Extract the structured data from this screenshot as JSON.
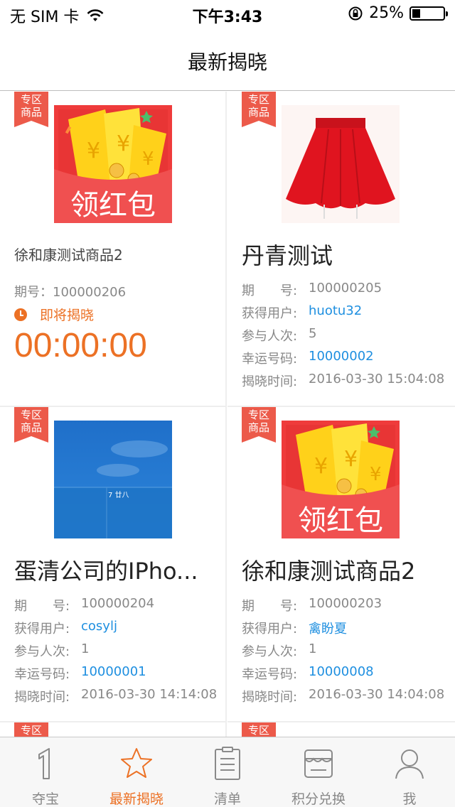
{
  "status_bar": {
    "carrier": "无 SIM 卡",
    "time": "下午3:43",
    "battery": "25%",
    "battery_level": 0.25
  },
  "nav": {
    "title": "最新揭晓"
  },
  "ribbon_text": "专区\n商品",
  "labels": {
    "period_prefix": "期号：",
    "period": "期　　号:",
    "winner": "获得用户:",
    "participants": "参与人次:",
    "lucky_code": "幸运号码:",
    "reveal_time": "揭晓时间:"
  },
  "items": [
    {
      "ribbon": "专区\n商品",
      "image": "red-envelope",
      "image_text": "领红包",
      "name": "徐和康测试商品2",
      "status": "pending",
      "period": "期号：100000206",
      "soon_text": "即将揭晓",
      "countdown": "00:00:00"
    },
    {
      "ribbon": "专区\n商品",
      "image": "red-skirt",
      "name": "丹青测试",
      "status": "revealed",
      "period": "100000205",
      "winner": "huotu32",
      "participants": "5",
      "lucky_code": "10000002",
      "reveal_time": "2016-03-30 15:04:08"
    },
    {
      "ribbon": "专区\n商品",
      "image": "phone-screen",
      "image_text": "7 廿八",
      "name": "蛋清公司的IPho...",
      "status": "revealed",
      "period": "100000204",
      "winner": "cosylj",
      "participants": "1",
      "lucky_code": "10000001",
      "reveal_time": "2016-03-30 14:14:08"
    },
    {
      "ribbon": "专区\n商品",
      "image": "red-envelope",
      "image_text": "领红包",
      "name": "徐和康测试商品2",
      "status": "revealed",
      "period": "100000203",
      "winner": "禽盼夏",
      "participants": "1",
      "lucky_code": "10000008",
      "reveal_time": "2016-03-30 14:04:08"
    }
  ],
  "partial_ribbons": [
    "专区",
    "专区"
  ],
  "tabs": [
    {
      "label": "夺宝",
      "icon": "one-icon",
      "active": false
    },
    {
      "label": "最新揭晓",
      "icon": "star-icon",
      "active": true
    },
    {
      "label": "清单",
      "icon": "list-icon",
      "active": false
    },
    {
      "label": "积分兑换",
      "icon": "shop-icon",
      "active": false
    },
    {
      "label": "我",
      "icon": "user-icon",
      "active": false
    }
  ],
  "colors": {
    "accent": "#ec7125",
    "link": "#1e8fe0",
    "ribbon": "#ec5a4a"
  }
}
